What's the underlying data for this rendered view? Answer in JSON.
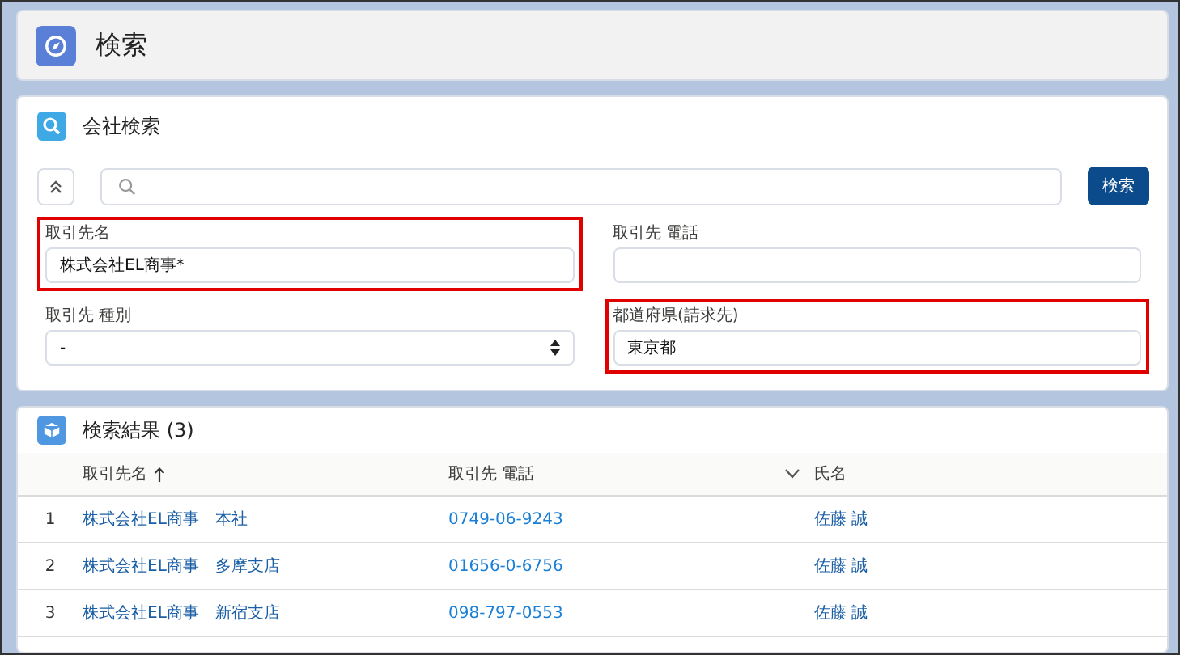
{
  "page": {
    "title": "検索"
  },
  "search_panel": {
    "title": "会社検索",
    "search_button": "検索",
    "fields": [
      {
        "kind": "text",
        "label": "取引先名",
        "value": "株式会社EL商事*",
        "highlighted": true
      },
      {
        "kind": "text",
        "label": "取引先 電話",
        "highlighted": false
      },
      {
        "kind": "select",
        "label": "取引先 種別",
        "value": "-",
        "highlighted": false
      },
      {
        "kind": "text",
        "label": "都道府県(請求先)",
        "value": "東京都",
        "highlighted": true
      }
    ]
  },
  "results": {
    "title": "検索結果 (3)",
    "columns": [
      {
        "label": "取引先名",
        "sorted_ascending": true
      },
      {
        "label": "取引先 電話",
        "sorted_ascending": false,
        "menu": true
      },
      {
        "label": "氏名",
        "sorted_ascending": false
      }
    ],
    "rows": [
      {
        "number": "1",
        "name": "株式会社EL商事　本社",
        "phone": "0749-06-9243",
        "contact": "佐藤 誠"
      },
      {
        "number": "2",
        "name": "株式会社EL商事　多摩支店",
        "phone": "01656-0-6756",
        "contact": "佐藤 誠"
      },
      {
        "number": "3",
        "name": "株式会社EL商事　新宿支店",
        "phone": "098-797-0553",
        "contact": "佐藤 誠"
      }
    ]
  }
}
